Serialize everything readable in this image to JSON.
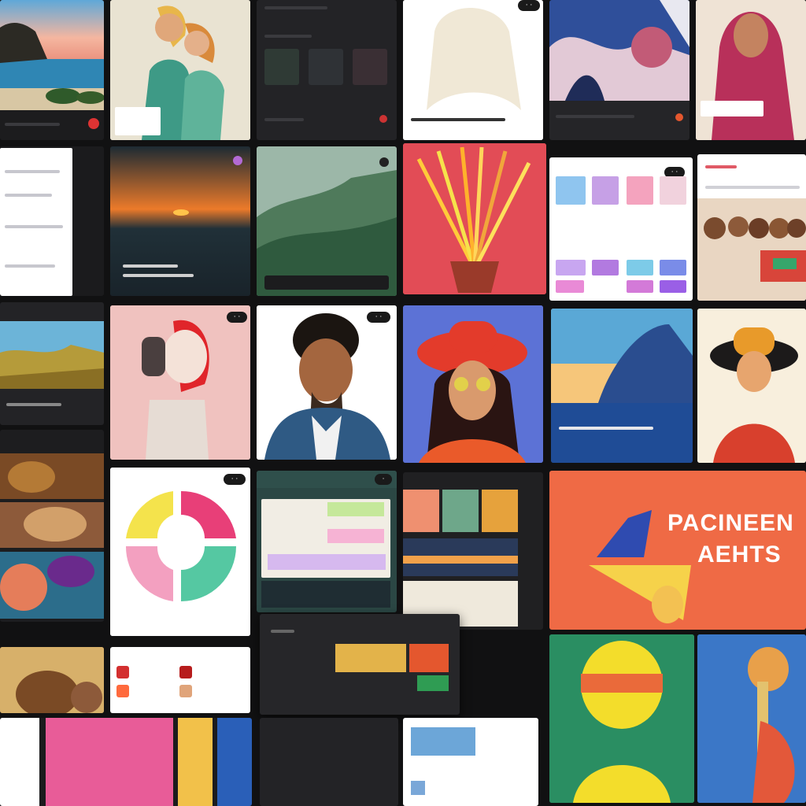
{
  "colors": {
    "background": "#111112",
    "accent_orange": "#ef6a45",
    "accent_pink": "#e86d97",
    "panel_dark": "#1e1e20"
  },
  "poster": {
    "title_line1": "PACINEEN",
    "title_line2": "AEHTS"
  },
  "icons": {
    "close": "close-icon",
    "menu": "more-icon",
    "record": "record-dot-icon"
  }
}
